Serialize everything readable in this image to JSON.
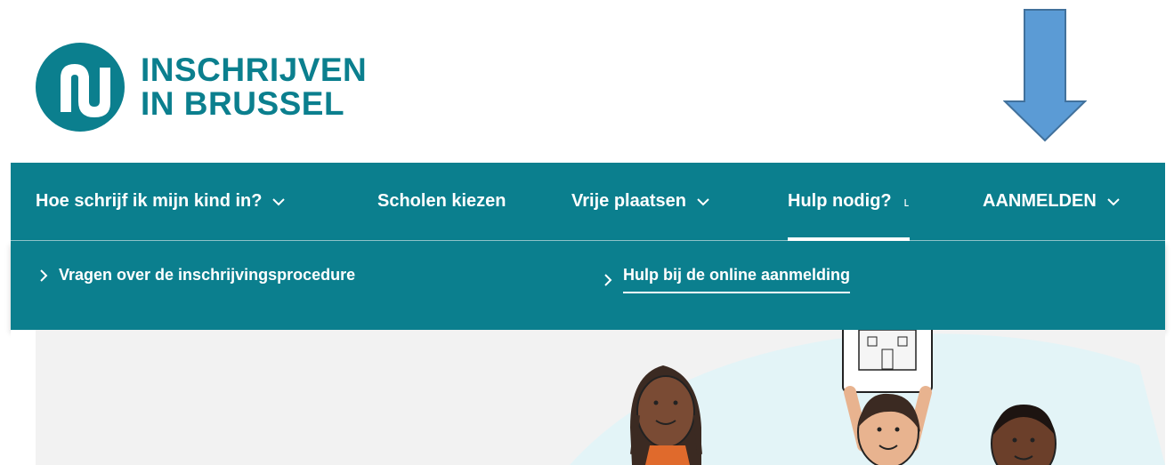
{
  "logo": {
    "line1": "INSCHRIJVEN",
    "line2": "IN BRUSSEL",
    "color": "#0b7f8e"
  },
  "nav": {
    "items": [
      {
        "label": "Hoe schrijf ik mijn kind in?",
        "has_dropdown": true
      },
      {
        "label": "Scholen kiezen",
        "has_dropdown": false
      },
      {
        "label": "Vrije plaatsen",
        "has_dropdown": true
      },
      {
        "label": "Hulp nodig?",
        "has_dropdown": false,
        "active": true,
        "loading": true
      },
      {
        "label": "AANMELDEN",
        "has_dropdown": true
      }
    ],
    "spinner_glyph": "˪"
  },
  "subnav": {
    "items": [
      {
        "label": "Vragen over de inschrijvingsprocedure",
        "active": false
      },
      {
        "label": "Hulp bij de online aanmelding",
        "active": true
      }
    ]
  },
  "annotation": {
    "arrow_color": "#5b9bd5",
    "arrow_direction": "down"
  },
  "colors": {
    "brand": "#0b7f8e",
    "hero_bg": "#f2f2f2"
  }
}
